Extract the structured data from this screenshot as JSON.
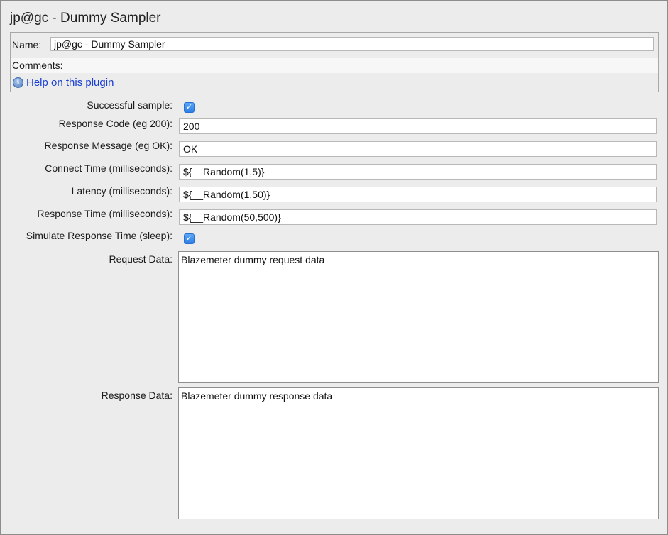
{
  "title": "jp@gc - Dummy Sampler",
  "name": {
    "label": "Name:",
    "value": "jp@gc - Dummy Sampler"
  },
  "comments": {
    "label": "Comments:"
  },
  "help": {
    "icon": "info-icon",
    "link_text": "Help on this plugin"
  },
  "fields": {
    "successful_sample": {
      "label": "Successful sample:",
      "checked": true
    },
    "response_code": {
      "label": "Response Code (eg 200):",
      "value": "200"
    },
    "response_message": {
      "label": "Response Message (eg OK):",
      "value": "OK"
    },
    "connect_time": {
      "label": "Connect Time (milliseconds):",
      "value": "${__Random(1,5)}"
    },
    "latency": {
      "label": "Latency (milliseconds):",
      "value": "${__Random(1,50)}"
    },
    "response_time": {
      "label": "Response Time (milliseconds):",
      "value": "${__Random(50,500)}"
    },
    "simulate_sleep": {
      "label": "Simulate Response Time (sleep):",
      "checked": true
    },
    "request_data": {
      "label": "Request Data:",
      "value": "Blazemeter dummy request data"
    },
    "response_data": {
      "label": "Response Data:",
      "value": "Blazemeter dummy response data"
    }
  },
  "colors": {
    "checkbox": "#3b8ef0",
    "link": "#1a3fd6"
  }
}
